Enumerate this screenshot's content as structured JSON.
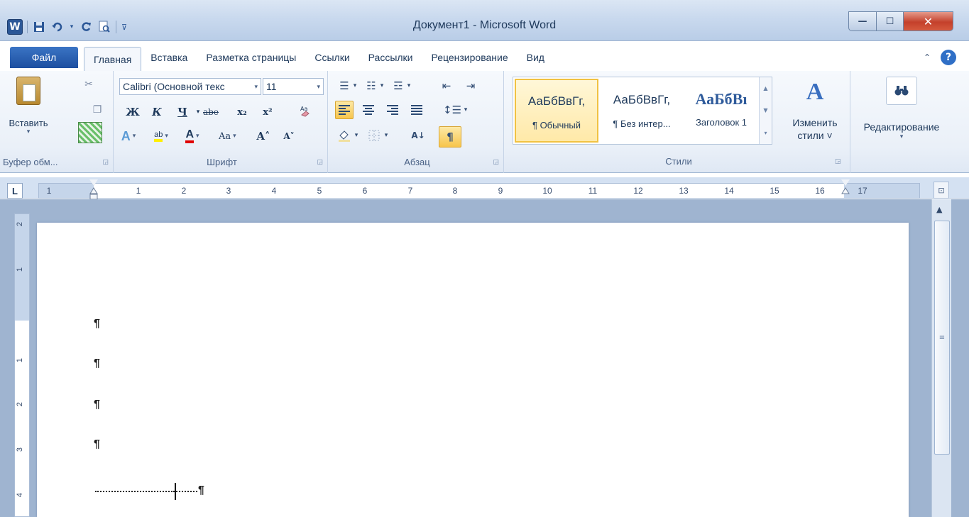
{
  "window": {
    "title": "Документ1 - Microsoft Word",
    "app_icon": "W",
    "minimize": "—",
    "maximize": "☐",
    "close": "✕"
  },
  "qat": {
    "save_icon": "save-icon",
    "undo_icon": "undo-icon",
    "redo_icon": "redo-icon",
    "print_preview_icon": "print-preview-icon"
  },
  "tabs": [
    {
      "label": "Файл"
    },
    {
      "label": "Главная"
    },
    {
      "label": "Вставка"
    },
    {
      "label": "Разметка страницы"
    },
    {
      "label": "Ссылки"
    },
    {
      "label": "Рассылки"
    },
    {
      "label": "Рецензирование"
    },
    {
      "label": "Вид"
    }
  ],
  "ribbon": {
    "clipboard": {
      "label": "Буфер обм...",
      "paste_label": "Вставить",
      "cut_icon": "scissors-icon",
      "copy_icon": "copy-icon"
    },
    "font": {
      "label": "Шрифт",
      "font_name": "Calibri (Основной текс",
      "font_size": "11",
      "bold": "Ж",
      "italic": "К",
      "underline": "Ч",
      "strike": "abe",
      "subscript": "x₂",
      "superscript": "x²",
      "change_case": "Aa",
      "grow": "A˄",
      "shrink": "A˅",
      "text_effects": "A",
      "highlight": "ab",
      "font_color": "A"
    },
    "paragraph": {
      "label": "Абзац",
      "show_marks": "¶",
      "sort": "А↓"
    },
    "styles": {
      "label": "Стили",
      "items": [
        {
          "preview": "АаБбВвГг,",
          "name": "¶ Обычный"
        },
        {
          "preview": "АаБбВвГг,",
          "name": "¶ Без интер..."
        },
        {
          "preview": "АаБбВı",
          "name": "Заголовок 1"
        }
      ],
      "change_styles_line1": "Изменить",
      "change_styles_line2": "стили ˅"
    },
    "editing": {
      "label": "Редактирование"
    }
  },
  "ruler": {
    "tab_selector": "L",
    "numbers": [
      "1",
      "1",
      "2",
      "3",
      "4",
      "5",
      "6",
      "7",
      "8",
      "9",
      "10",
      "11",
      "12",
      "13",
      "14",
      "15",
      "16",
      "17"
    ],
    "vertical_numbers": [
      "2",
      "1",
      "1",
      "2",
      "3",
      "4"
    ]
  },
  "document": {
    "paragraph_mark": "¶"
  },
  "colors": {
    "accent": "#2b5797",
    "ribbon_bg": "#eaf0f8",
    "workspace_bg": "#9fb4d0",
    "active_button": "#f7c54c"
  }
}
